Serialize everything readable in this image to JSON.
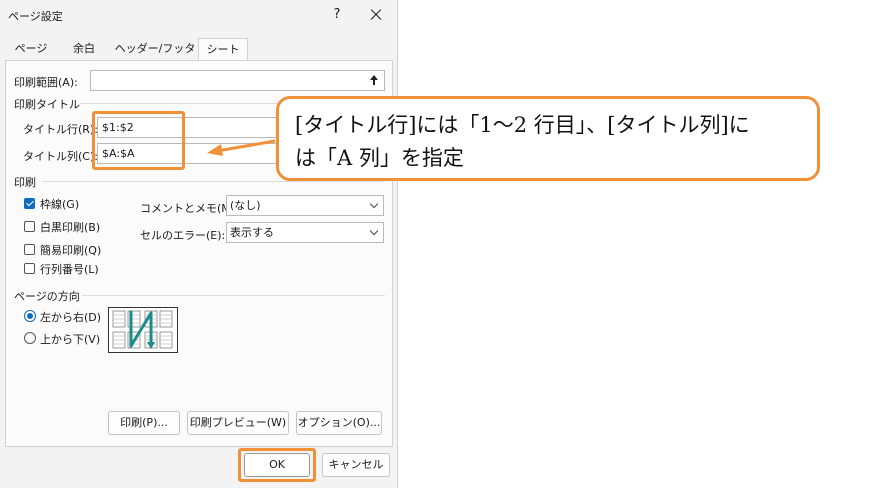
{
  "dialog": {
    "title": "ページ設定",
    "help": "?",
    "tabs": [
      "ページ",
      "余白",
      "ヘッダー/フッター",
      "シート"
    ],
    "active_tab": "シート"
  },
  "print_area": {
    "label": "印刷範囲(A):",
    "value": ""
  },
  "print_titles": {
    "group_label": "印刷タイトル",
    "rows_label": "タイトル行(R):",
    "rows_value": "$1:$2",
    "cols_label": "タイトル列(C):",
    "cols_value": "$A:$A"
  },
  "print": {
    "group_label": "印刷",
    "gridlines": {
      "label": "枠線(G)",
      "checked": true
    },
    "black_white": {
      "label": "白黒印刷(B)",
      "checked": false
    },
    "draft": {
      "label": "簡易印刷(Q)",
      "checked": false
    },
    "headings": {
      "label": "行列番号(L)",
      "checked": false
    },
    "comments_label": "コメントとメモ(M):",
    "comments_value": "(なし)",
    "errors_label": "セルのエラー(E):",
    "errors_value": "表示する"
  },
  "page_order": {
    "group_label": "ページの方向",
    "over_then_down": {
      "label": "左から右(D)",
      "checked": true
    },
    "down_then_over": {
      "label": "上から下(V)",
      "checked": false
    }
  },
  "buttons": {
    "print": "印刷(P)...",
    "preview": "印刷プレビュー(W)",
    "options": "オプション(O)...",
    "ok": "OK",
    "cancel": "キャンセル"
  },
  "callout": {
    "line1": "[タイトル行]には「1～2 行目」、[タイトル列]に",
    "line2": "は「A 列」を指定"
  },
  "colors": {
    "accent": "#f0913a",
    "check_blue": "#0f6cbd"
  }
}
